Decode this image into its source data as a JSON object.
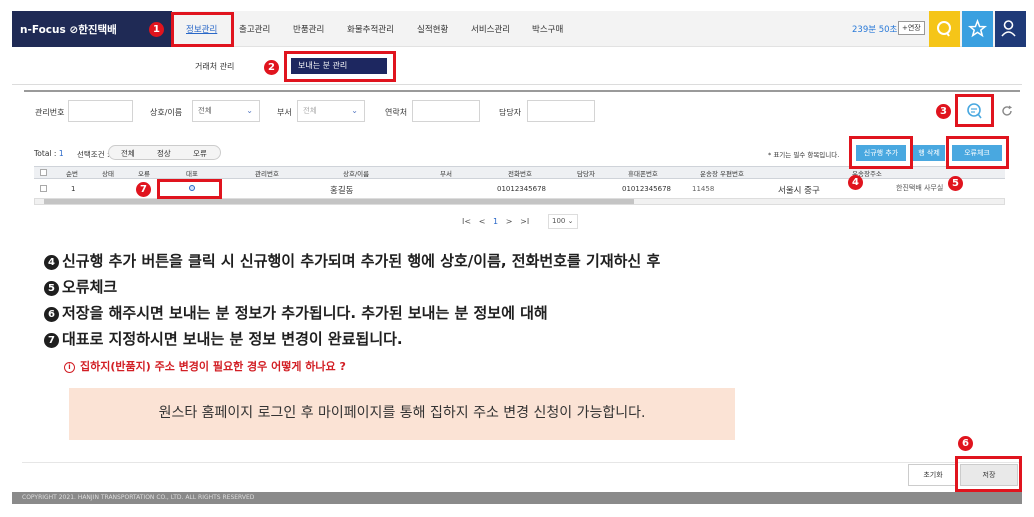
{
  "app": {
    "logo": "n-Focus ⊘한진택배"
  },
  "nav": {
    "items": [
      "정보관리",
      "출고관리",
      "반품관리",
      "화물추적관리",
      "실적현황",
      "서비스관리",
      "박스구매"
    ],
    "active_index": 0
  },
  "session": {
    "timer": "239분 50초",
    "extend_label": "+연장"
  },
  "icons": {
    "search_round": "search-round-icon",
    "star": "star-icon",
    "user": "user-icon",
    "refresh": "refresh-icon",
    "magnifier": "magnifier-icon"
  },
  "submenu": {
    "client": "거래처 관리",
    "sender": "보내는 분 관리"
  },
  "search": {
    "mgmt_no_label": "관리번호",
    "name_label": "상호/이름",
    "name_select": "전체",
    "dept_label": "부서",
    "dept_select": "전체",
    "contact_label": "연락처",
    "manager_label": "담당자"
  },
  "grid_toolbar": {
    "total_label": "Total :",
    "total_count": "1",
    "cond_label": "선택조건 :",
    "filters": [
      "전체",
      "정상",
      "오류"
    ],
    "required_note": "* 표기는 필수 항목입니다.",
    "add_row": "신규행 추가",
    "delete_row": "행 삭제",
    "error_check": "오류체크"
  },
  "table": {
    "headers": [
      "순번",
      "상태",
      "오류",
      "대표",
      "관리번호",
      "상호/이름",
      "부서",
      "전화번호",
      "담당자",
      "휴대폰번호",
      "운송장 우편번호",
      "운송장주소"
    ],
    "row": {
      "seq": "1",
      "name": "홍길동",
      "phone": "01012345678",
      "mobile": "01012345678",
      "zip": "11458",
      "addr1": "서울시 중구",
      "addr2": "한진택배 사무실"
    }
  },
  "pager": {
    "first": "I<",
    "prev": "<",
    "current": "1",
    "next": ">",
    "last": ">I",
    "page_size": "100"
  },
  "markers": [
    "1",
    "2",
    "3",
    "4",
    "5",
    "6",
    "7"
  ],
  "instructions": {
    "steps": [
      {
        "num": "4",
        "text": "신규행 추가 버튼을 클릭 시 신규행이 추가되며 추가된 행에 상호/이름, 전화번호를 기재하신 후"
      },
      {
        "num": "5",
        "text": "오류체크"
      },
      {
        "num": "6",
        "text": "저장을 해주시면 보내는 분 정보가 추가됩니다. 추가된 보내는 분 정보에 대해"
      },
      {
        "num": "7",
        "text": "대표로 지정하시면 보내는 분 정보 변경이 완료됩니다."
      }
    ],
    "faq_icon": "i",
    "faq": "집하지(반품지) 주소 변경이 필요한 경우 어떻게 하나요 ?",
    "answer": "원스타 홈페이지 로그인 후 마이페이지를 통해 집하지 주소 변경 신청이 가능합니다."
  },
  "buttons": {
    "reset": "초기화",
    "save": "저장"
  },
  "footer": "COPYRIGHT 2021. HANJIN TRANSPORTATION CO., LTD. ALL RIGHTS RESERVED",
  "colors": {
    "navy": "#1d2760",
    "accent_blue": "#49a8e0",
    "marker_red": "#e0141e",
    "yellow": "#f5c518",
    "sky": "#3aa0e0",
    "navy_icon": "#1f3a78"
  }
}
